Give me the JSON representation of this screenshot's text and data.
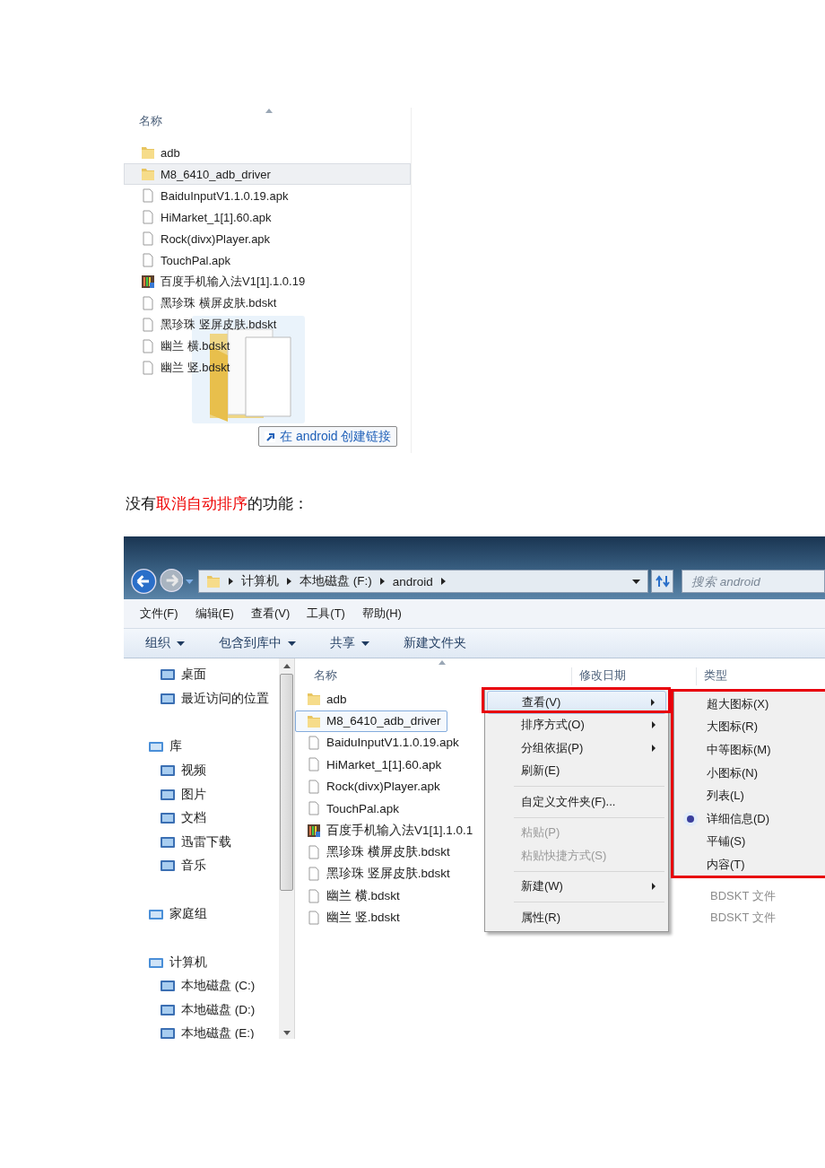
{
  "drag_shot": {
    "column": "名称",
    "files": [
      {
        "name": "adb",
        "kind": "folder",
        "selected": false
      },
      {
        "name": "M8_6410_adb_driver",
        "kind": "folder",
        "selected": true
      },
      {
        "name": "BaiduInputV1.1.0.19.apk",
        "kind": "file",
        "selected": false
      },
      {
        "name": "HiMarket_1[1].60.apk",
        "kind": "file",
        "selected": false
      },
      {
        "name": "Rock(divx)Player.apk",
        "kind": "file",
        "selected": false
      },
      {
        "name": "TouchPal.apk",
        "kind": "file",
        "selected": false
      },
      {
        "name": "百度手机输入法V1[1].1.0.19",
        "kind": "app",
        "selected": false
      },
      {
        "name": "黑珍珠 横屏皮肤.bdskt",
        "kind": "file",
        "selected": false
      },
      {
        "name": "黑珍珠 竖屏皮肤.bdskt",
        "kind": "file",
        "selected": false
      },
      {
        "name": "幽兰 横.bdskt",
        "kind": "file",
        "selected": false
      },
      {
        "name": "幽兰 竖.bdskt",
        "kind": "file",
        "selected": false
      }
    ],
    "drop_tip": "在 android 创建链接"
  },
  "caption": [
    {
      "text": "没有",
      "highlight": false
    },
    {
      "text": "取消自动排序",
      "highlight": true
    },
    {
      "text": "的功能：",
      "highlight": false
    }
  ],
  "explorer": {
    "breadcrumbs": [
      "计算机",
      "本地磁盘 (F:)",
      "android"
    ],
    "search": {
      "placeholder": "搜索 android"
    },
    "menu_bar": [
      "文件(F)",
      "编辑(E)",
      "查看(V)",
      "工具(T)",
      "帮助(H)"
    ],
    "toolbar": [
      {
        "label": "组织",
        "dropdown": true
      },
      {
        "label": "包含到库中",
        "dropdown": true
      },
      {
        "label": "共享",
        "dropdown": true
      },
      {
        "label": "新建文件夹",
        "dropdown": false
      }
    ],
    "sidebar": [
      {
        "children": [
          "桌面",
          "最近访问的位置"
        ]
      },
      {
        "label": "库",
        "children": [
          "视频",
          "图片",
          "文档",
          "迅雷下载",
          "音乐"
        ]
      },
      {
        "label": "家庭组"
      },
      {
        "label": "计算机",
        "children": [
          "本地磁盘 (C:)",
          "本地磁盘 (D:)",
          "本地磁盘 (E:)"
        ]
      }
    ],
    "columns": [
      "名称",
      "修改日期",
      "类型"
    ],
    "files": [
      {
        "name": "adb",
        "kind": "folder",
        "selected": false
      },
      {
        "name": "M8_6410_adb_driver",
        "kind": "folder",
        "selected": true
      },
      {
        "name": "BaiduInputV1.1.0.19.apk",
        "kind": "file",
        "selected": false
      },
      {
        "name": "HiMarket_1[1].60.apk",
        "kind": "file",
        "selected": false
      },
      {
        "name": "Rock(divx)Player.apk",
        "kind": "file",
        "selected": false
      },
      {
        "name": "TouchPal.apk",
        "kind": "file",
        "selected": false
      },
      {
        "name": "百度手机输入法V1[1].1.0.1",
        "kind": "app",
        "selected": false
      },
      {
        "name": "黑珍珠 横屏皮肤.bdskt",
        "kind": "file",
        "selected": false
      },
      {
        "name": "黑珍珠 竖屏皮肤.bdskt",
        "kind": "file",
        "selected": false
      },
      {
        "name": "幽兰 横.bdskt",
        "kind": "file",
        "selected": false,
        "type": "BDSKT 文件"
      },
      {
        "name": "幽兰 竖.bdskt",
        "kind": "file",
        "selected": false,
        "type": "BDSKT 文件"
      }
    ],
    "context_menu": [
      {
        "kind": "item",
        "label": "查看(V)",
        "submenu": true,
        "disabled": false,
        "selected": true
      },
      {
        "kind": "item",
        "label": "排序方式(O)",
        "submenu": true,
        "disabled": false,
        "selected": false
      },
      {
        "kind": "item",
        "label": "分组依据(P)",
        "submenu": true,
        "disabled": false,
        "selected": false
      },
      {
        "kind": "item",
        "label": "刷新(E)",
        "submenu": false,
        "disabled": false,
        "selected": false
      },
      {
        "kind": "separator"
      },
      {
        "kind": "item",
        "label": "自定义文件夹(F)...",
        "submenu": false,
        "disabled": false,
        "selected": false
      },
      {
        "kind": "separator"
      },
      {
        "kind": "item",
        "label": "粘贴(P)",
        "submenu": false,
        "disabled": true,
        "selected": false
      },
      {
        "kind": "item",
        "label": "粘贴快捷方式(S)",
        "submenu": false,
        "disabled": true,
        "selected": false
      },
      {
        "kind": "separator"
      },
      {
        "kind": "item",
        "label": "新建(W)",
        "submenu": true,
        "disabled": false,
        "selected": false
      },
      {
        "kind": "separator"
      },
      {
        "kind": "item",
        "label": "属性(R)",
        "submenu": false,
        "disabled": false,
        "selected": false
      }
    ],
    "view_submenu": [
      {
        "label": "超大图标(X)",
        "selected": false
      },
      {
        "label": "大图标(R)",
        "selected": false
      },
      {
        "label": "中等图标(M)",
        "selected": false
      },
      {
        "label": "小图标(N)",
        "selected": false
      },
      {
        "label": "列表(L)",
        "selected": false
      },
      {
        "label": "详细信息(D)",
        "selected": true
      },
      {
        "label": "平铺(S)",
        "selected": false
      },
      {
        "label": "内容(T)",
        "selected": false
      }
    ]
  }
}
